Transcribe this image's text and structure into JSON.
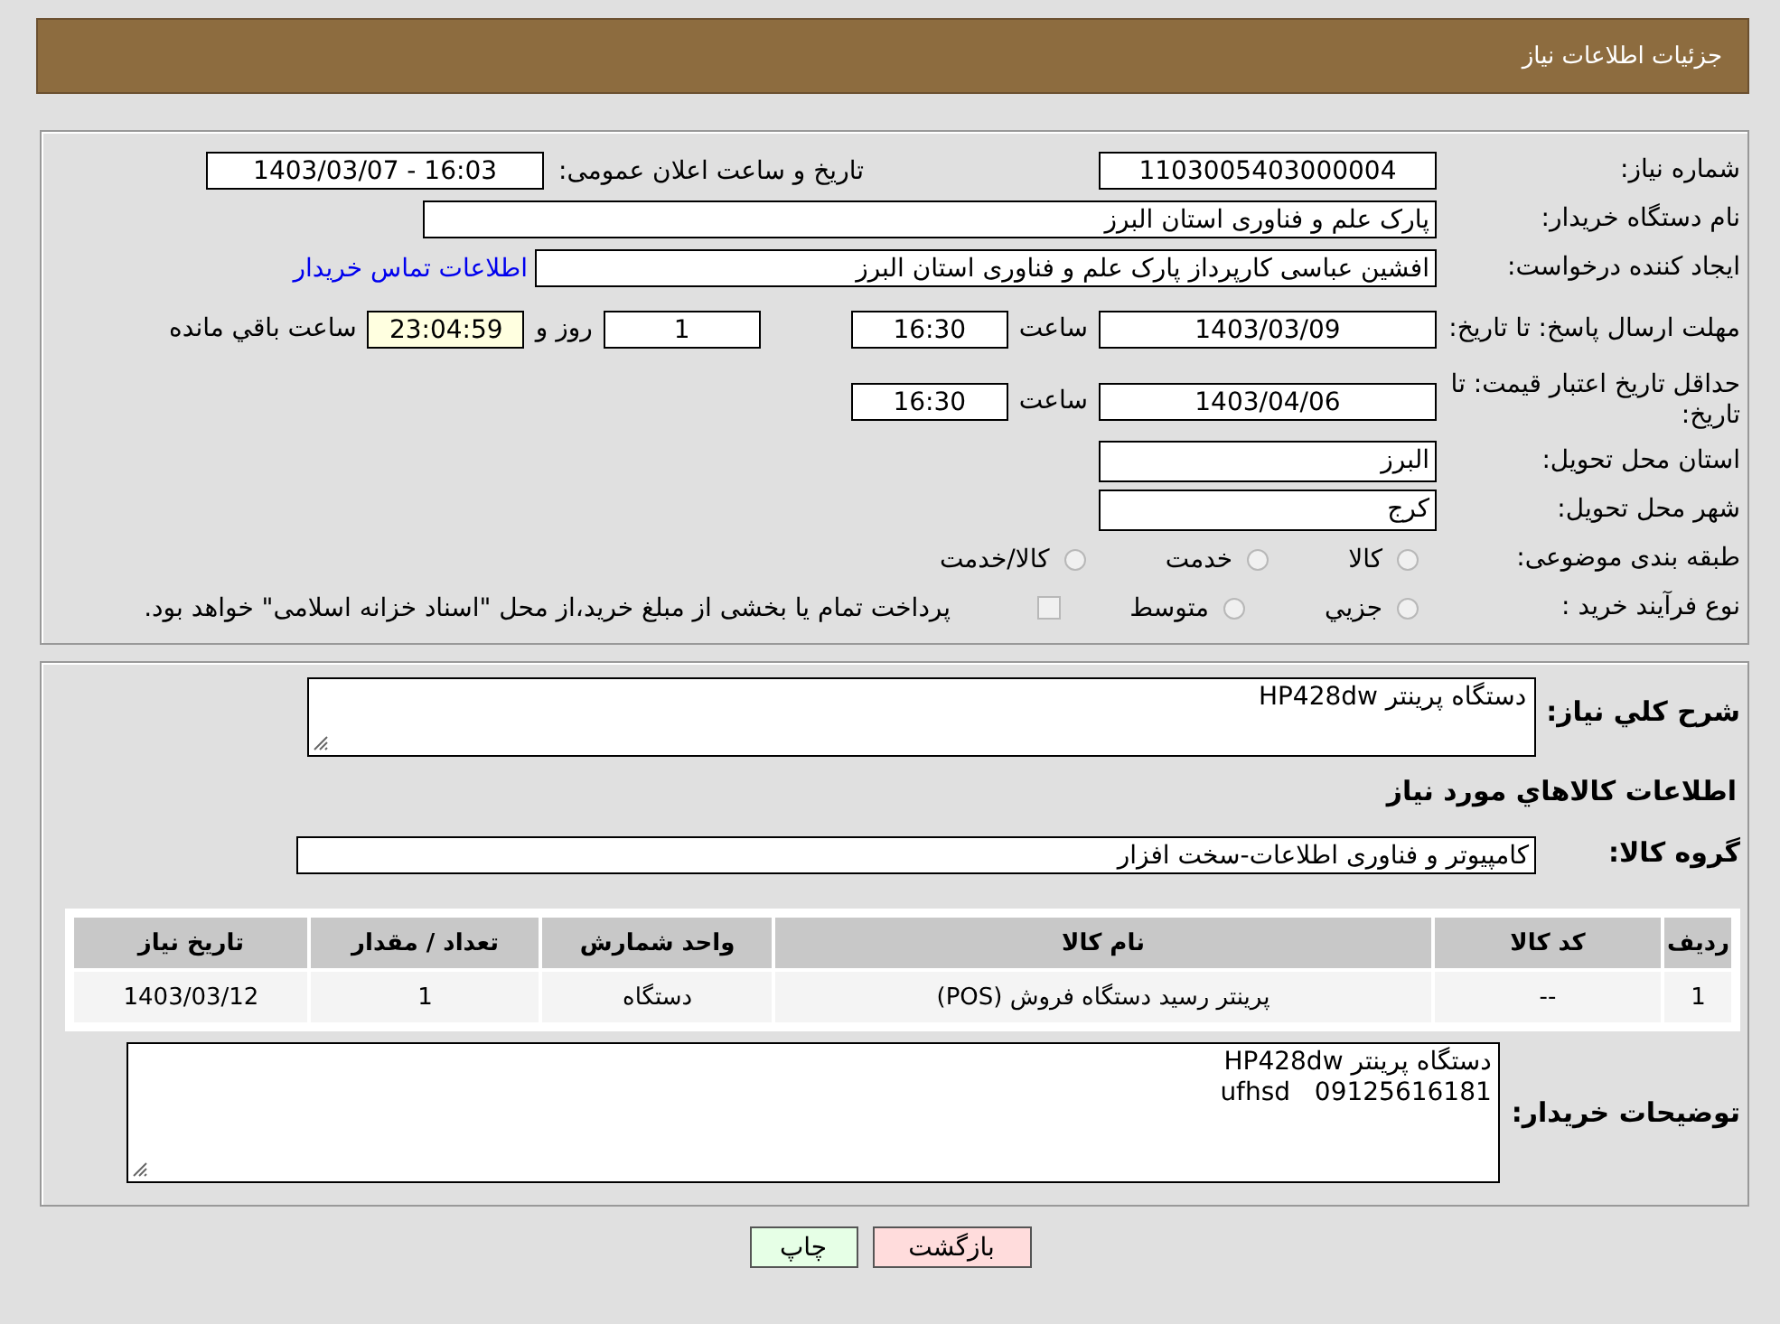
{
  "header": {
    "title": "جزئیات اطلاعات نیاز"
  },
  "details": {
    "need_number": {
      "label": "شماره نیاز:",
      "value": "1103005403000004"
    },
    "announce": {
      "label": "تاریخ و ساعت اعلان عمومی:",
      "value": "1403/03/07 - 16:03"
    },
    "buyer": {
      "label": "نام دستگاه خریدار:",
      "value": "پارک علم و فناوری استان البرز"
    },
    "creator": {
      "label": "ایجاد کننده درخواست:",
      "value": "افشین  عباسی  کارپرداز پارک علم و فناوری استان البرز",
      "link": "اطلاعات تماس خریدار"
    },
    "reply_deadline": {
      "label": "مهلت ارسال پاسخ: تا تاریخ:",
      "date": "1403/03/09",
      "time_label": "ساعت",
      "time": "16:30",
      "days": "1",
      "days_label": "روز و",
      "remaining": "23:04:59",
      "remaining_label": "ساعت باقي مانده"
    },
    "price_validity": {
      "label": "حداقل تاریخ اعتبار قیمت: تا تاریخ:",
      "date": "1403/04/06",
      "time_label": "ساعت",
      "time": "16:30"
    },
    "province": {
      "label": "استان محل تحویل:",
      "value": "البرز"
    },
    "city": {
      "label": "شهر محل تحویل:",
      "value": "کرج"
    },
    "category": {
      "label": "طبقه بندی موضوعی:",
      "options": [
        {
          "label": "کالا",
          "selected": false
        },
        {
          "label": "خدمت",
          "selected": false
        },
        {
          "label": "کالا/خدمت",
          "selected": false
        }
      ]
    },
    "process": {
      "label": "نوع فرآیند خرید :",
      "options": [
        {
          "label": "جزيي",
          "selected": false
        },
        {
          "label": "متوسط",
          "selected": false
        }
      ],
      "payment": {
        "label": "پرداخت تمام یا بخشی از مبلغ خرید،از محل \"اسناد خزانه اسلامی\" خواهد بود.",
        "checked": false
      }
    }
  },
  "summary": {
    "description": {
      "label": "شرح کلي نياز:",
      "value": "دستگاه پرینتر HP428dw"
    },
    "items_heading": "اطلاعات کالاهاي مورد نياز",
    "group": {
      "label": "گروه کالا:",
      "value": "کامپیوتر و فناوری اطلاعات-سخت افزار"
    },
    "table": {
      "columns": [
        "ردیف",
        "کد کالا",
        "نام کالا",
        "واحد شمارش",
        "تعداد / مقدار",
        "تاریخ نیاز"
      ],
      "rows": [
        [
          "1",
          "--",
          "پرینتر رسید دستگاه فروش (POS)",
          "دستگاه",
          "1",
          "1403/03/12"
        ]
      ]
    },
    "notes": {
      "label": "توضیحات خریدار:",
      "lines": [
        "دستگاه پرینتر HP428dw",
        "09125616181   ufhsd"
      ]
    }
  },
  "buttons": [
    {
      "label": "بازگشت",
      "kind": "back"
    },
    {
      "label": "چاپ",
      "kind": "print"
    }
  ]
}
